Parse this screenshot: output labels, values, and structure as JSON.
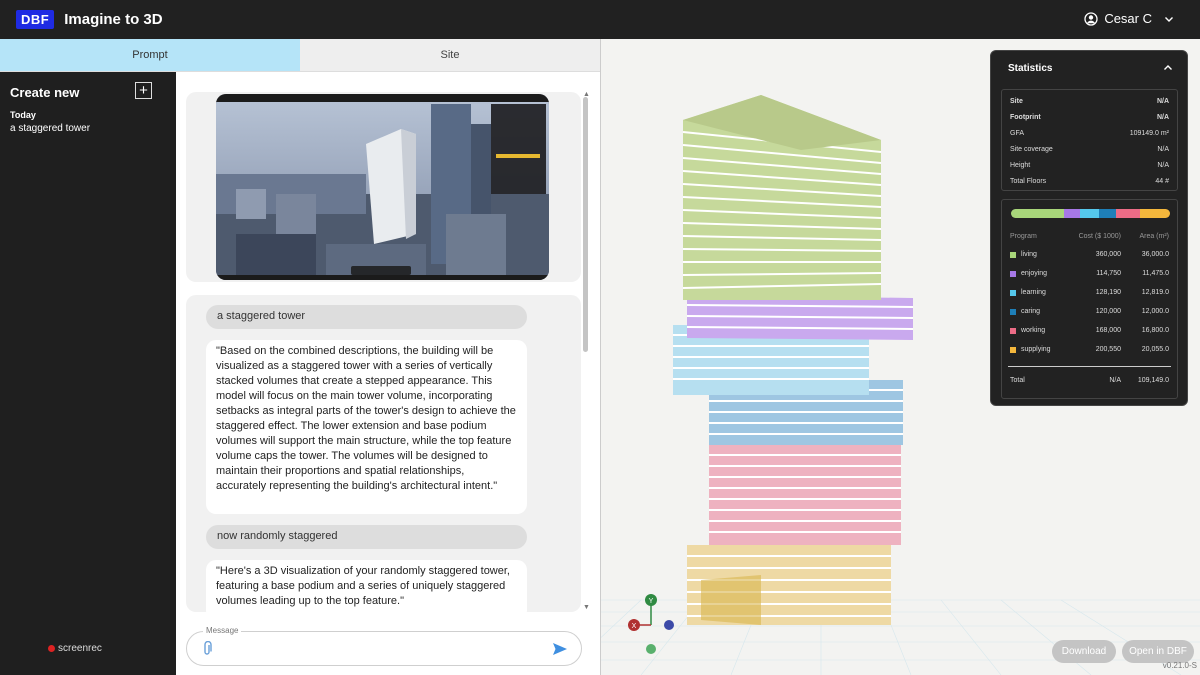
{
  "app": {
    "logo": "DBF",
    "title": "Imagine to 3D",
    "user": "Cesar C"
  },
  "tabs": [
    {
      "label": "Prompt"
    },
    {
      "label": "Site"
    }
  ],
  "sidebar": {
    "create_label": "Create new",
    "section": "Today",
    "history": [
      "a staggered tower"
    ],
    "recorder": "screenrec"
  },
  "chat": {
    "messages": [
      {
        "role": "user",
        "text": "a staggered tower"
      },
      {
        "role": "assistant",
        "text": "\"Based on the combined descriptions, the building will be visualized as a staggered tower with a series of vertically stacked volumes that create a stepped appearance. This model will focus on the main tower volume, incorporating setbacks as integral parts of the tower's design to achieve the staggered effect. The lower extension and base podium volumes will support the main structure, while the top feature volume caps the tower. The volumes will be designed to maintain their proportions and spatial relationships, accurately representing the building's architectural intent.\""
      },
      {
        "role": "user",
        "text": "now randomly staggered"
      },
      {
        "role": "assistant",
        "text": "\"Here's a 3D visualization of your randomly staggered tower, featuring a base podium and a series of uniquely staggered volumes leading up to the top feature.\""
      }
    ],
    "input_label": "Message",
    "input_value": ""
  },
  "stats": {
    "title": "Statistics",
    "summary": [
      {
        "label": "Site",
        "value": "N/A"
      },
      {
        "label": "Footprint",
        "value": "N/A"
      },
      {
        "label": "GFA",
        "value": "109149.0 m²"
      },
      {
        "label": "Site coverage",
        "value": "N/A"
      },
      {
        "label": "Height",
        "value": "N/A"
      },
      {
        "label": "Total Floors",
        "value": "44 #"
      }
    ],
    "program_headers": {
      "program": "Program",
      "cost": "Cost ($ 1000)",
      "area": "Area (m²)"
    },
    "programs": [
      {
        "name": "living",
        "cost": "360,000",
        "area": "36,000.0",
        "color": "#a8d67a"
      },
      {
        "name": "enjoying",
        "cost": "114,750",
        "area": "11,475.0",
        "color": "#a678e6"
      },
      {
        "name": "learning",
        "cost": "128,190",
        "area": "12,819.0",
        "color": "#55c8ec"
      },
      {
        "name": "caring",
        "cost": "120,000",
        "area": "12,000.0",
        "color": "#1e7fb8"
      },
      {
        "name": "working",
        "cost": "168,000",
        "area": "16,800.0",
        "color": "#ec6c86"
      },
      {
        "name": "supplying",
        "cost": "200,550",
        "area": "20,055.0",
        "color": "#f4b73c"
      }
    ],
    "total": {
      "label": "Total",
      "cost": "N/A",
      "area": "109,149.0"
    }
  },
  "viewer": {
    "axes": {
      "y": "Y",
      "x": "X"
    },
    "download_label": "Download",
    "open_label": "Open in DBF",
    "version": "v0.21.0-S"
  }
}
